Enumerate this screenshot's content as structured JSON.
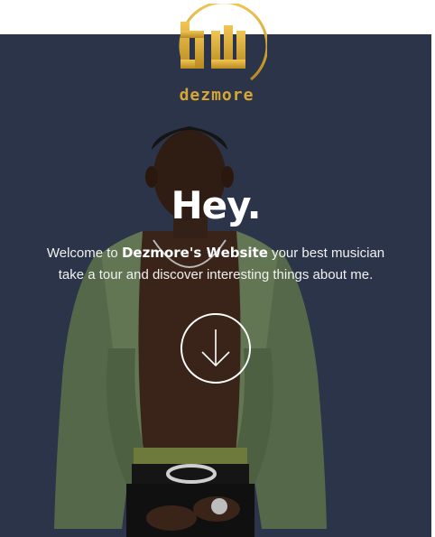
{
  "brand": {
    "logo_word": "dezmore",
    "logo_monogram": "dw",
    "gold": "#d7a734"
  },
  "hero": {
    "background": "#2b3449",
    "greeting": "Hey.",
    "welcome_prefix": "Welcome to ",
    "welcome_name": "Dezmore's Website",
    "welcome_suffix": " your best musician",
    "welcome_line2": "take a tour and discover interesting things about me.",
    "scroll_icon": "arrow-down-icon"
  }
}
